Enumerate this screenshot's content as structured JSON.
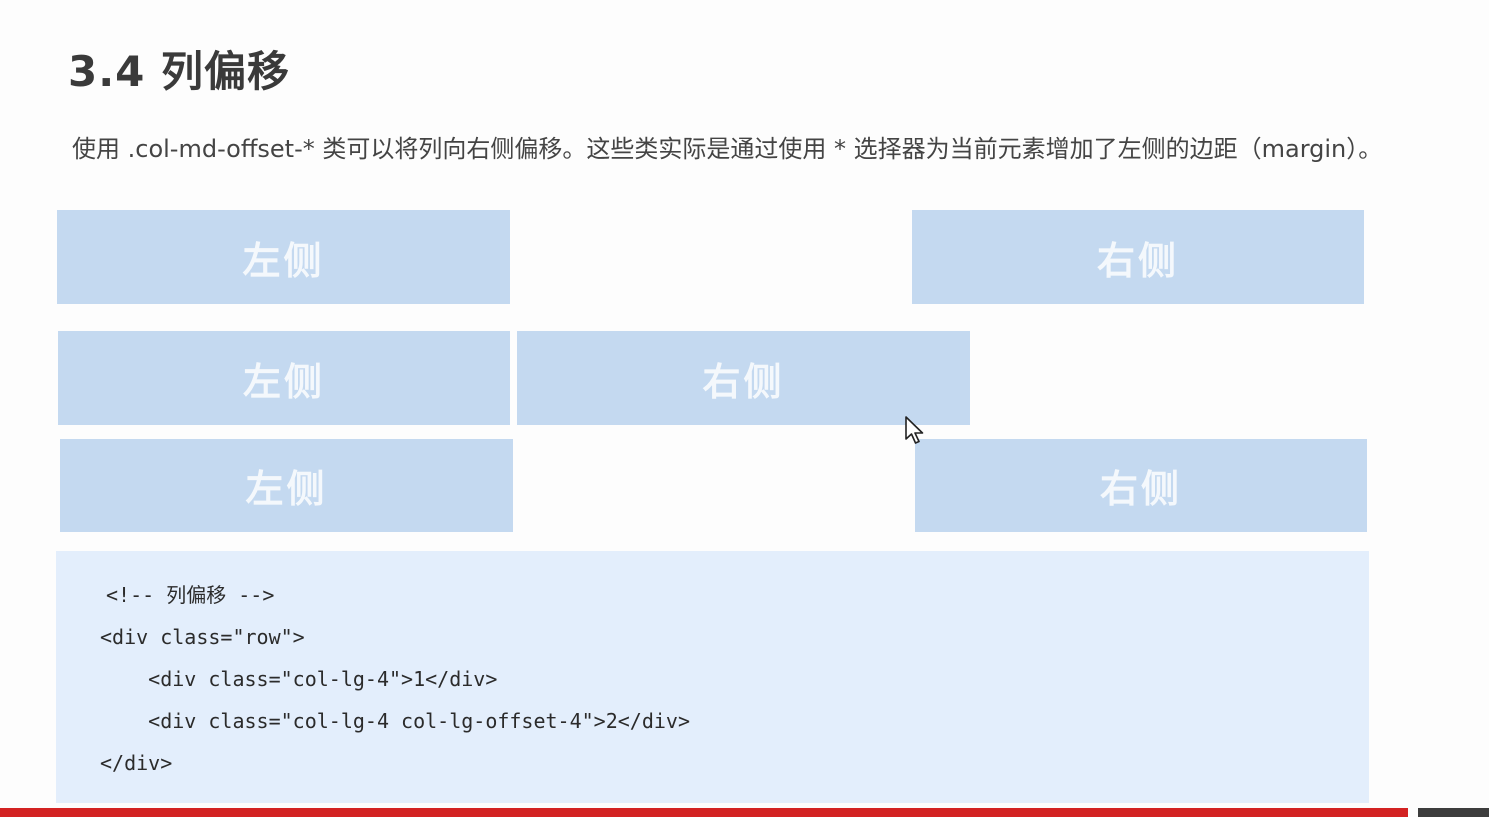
{
  "slide": {
    "title": "3.4 列偏移",
    "description": "使用 .col-md-offset-* 类可以将列向右侧偏移。这些类实际是通过使用 * 选择器为当前元素增加了左侧的边距（margin）。"
  },
  "demo": {
    "row1": {
      "left": "左侧",
      "right": "右侧"
    },
    "row2": {
      "left": "左侧",
      "right": "右侧"
    },
    "row3": {
      "left": "左侧",
      "right": "右侧"
    }
  },
  "code": {
    "lines": [
      "<!-- 列偏移 -->",
      "<div class=\"row\">",
      "    <div class=\"col-lg-4\">1</div>",
      "    <div class=\"col-lg-4 col-lg-offset-4\">2</div>",
      "</div>"
    ]
  },
  "colors": {
    "box": "#c4d9f0",
    "box_text": "#f4f8fc",
    "code_bg": "#e3eefc",
    "bar_red": "#d32222",
    "bar_dark": "#3d3d3d"
  },
  "icons": {
    "cursor": "mouse-pointer-icon"
  }
}
